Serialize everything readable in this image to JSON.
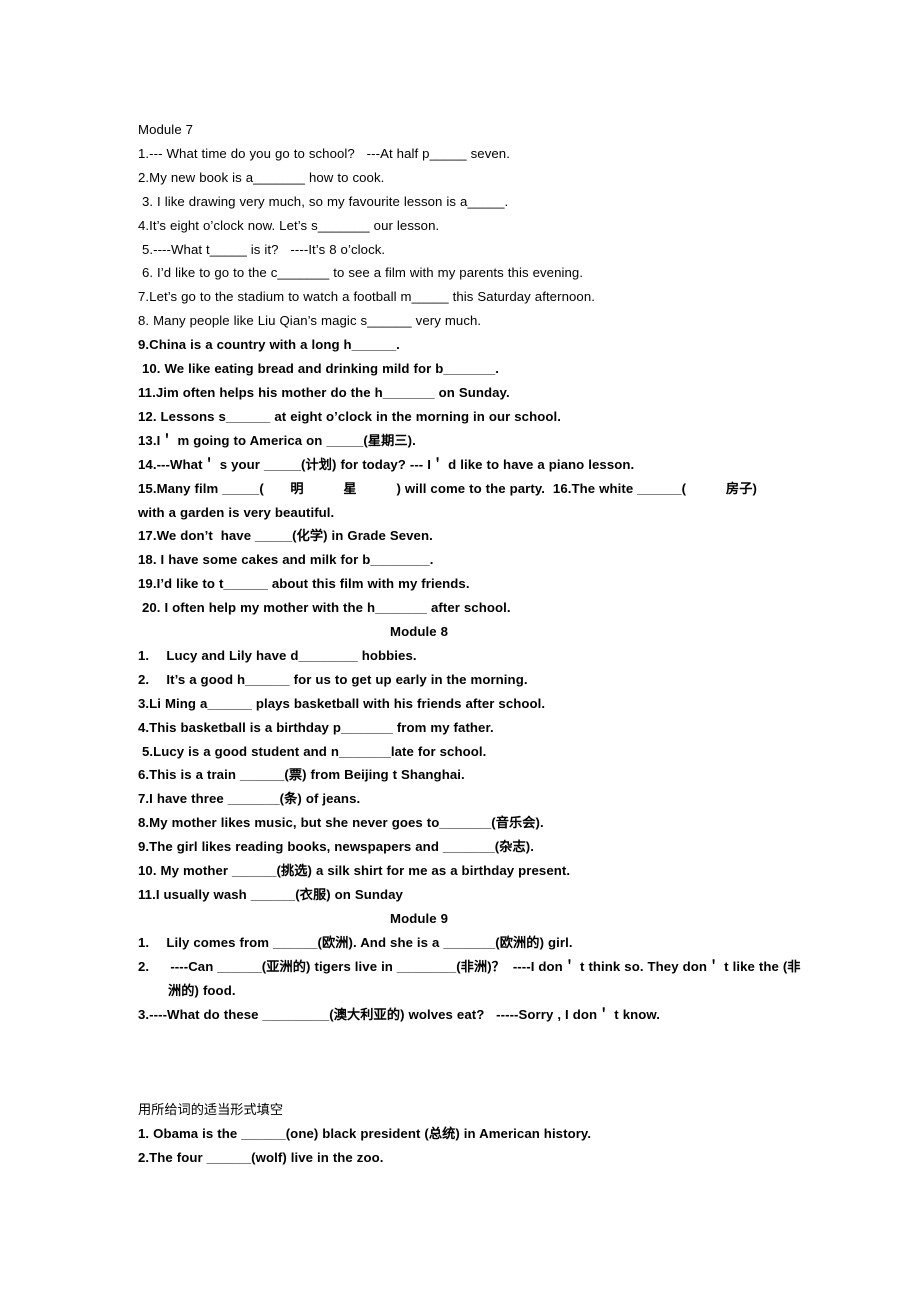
{
  "document": {
    "module7": {
      "title": "Module 7",
      "items": [
        "1.--- What time do you go to school?   ---At half p_____ seven.",
        "2.My new book is a_______ how to cook.",
        " 3. I like drawing very much, so my favourite lesson is a_____.",
        "4.It’s eight o’clock now. Let’s s_______ our lesson.",
        " 5.----What t_____ is it?   ----It’s 8 o’clock.",
        " 6. I’d like to go to the c_______ to see a film with my parents this evening.",
        "7.Let’s go to the stadium to watch a football m_____ this Saturday afternoon.",
        "8. Many people like Liu Qian’s magic s______ very much."
      ],
      "items_bold": [
        "9.China is a country with a long h______.",
        " 10. We like eating bread and drinking mild for b_______.",
        "11.Jim often helps his mother do the h_______ on Sunday.",
        "12. Lessons s______ at eight o’clock in the morning in our school.",
        "13.I＇ m going to America on _____(星期三).",
        "14.---What＇ s your _____(计划) for today? --- I＇ d like to have a piano lesson.",
        "15.Many film _____(　　明　　　星　　　) will come to the party.  16.The white ______(　　　房子) with a garden is very beautiful.",
        "17.We don’t  have _____(化学) in Grade Seven.",
        "18. I have some cakes and milk for b________.",
        "19.I’d like to t______ about this film with my friends.",
        " 20. I often help my mother with the h_______ after school."
      ]
    },
    "module8": {
      "title": "Module 8",
      "items": [
        "1.　 Lucy and Lily have d________ hobbies.",
        "2.　 It’s a good h______ for us to get up early in the morning.",
        "3.Li Ming a______ plays basketball with his friends after school.",
        "4.This basketball is a birthday p_______ from my father.",
        " 5.Lucy is a good student and n_______late for school.",
        "6.This is a train ______(票) from Beijing t Shanghai.",
        "7.I have three _______(条) of jeans.",
        "8.My mother likes music, but she never goes to_______(音乐会).",
        "9.The girl likes reading books, newspapers and _______(杂志).",
        "10. My mother ______(挑选) a silk shirt for me as a birthday present.",
        "11.I usually wash ______(衣服) on Sunday"
      ]
    },
    "module9": {
      "title": "Module 9",
      "items": [
        "1.　 Lily comes from ______(欧洲). And she is a _______(欧洲的) girl.",
        "2.　  ----Can ______(亚洲的) tigers live in ________(非洲)？  ----I don＇ t think so. They don＇ t like the (非洲的) food.",
        "3.----What do these _________(澳大利亚的) wolves eat?   -----Sorry , I don＇ t know."
      ]
    },
    "section4": {
      "heading": "用所给词的适当形式填空",
      "items": [
        "1. Obama is the ______(one) black president (总统) in American history.",
        "2.The four ______(wolf) live in the zoo."
      ]
    }
  }
}
